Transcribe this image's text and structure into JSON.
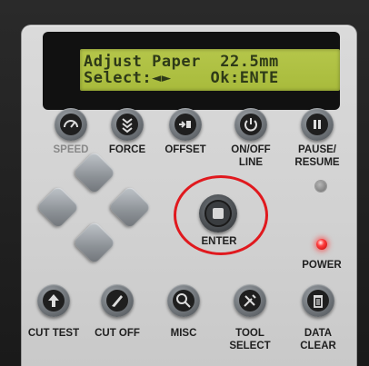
{
  "lcd": {
    "line1": "Adjust Paper  22.5mm",
    "line2": "Select:◄►    Ok:ENTE"
  },
  "buttons": {
    "speed": {
      "label": "SPEED",
      "icon": "speedometer-icon"
    },
    "force": {
      "label": "FORCE",
      "icon": "force-down-arrows-icon"
    },
    "offset": {
      "label": "OFFSET",
      "icon": "offset-icon"
    },
    "online": {
      "label_line1": "ON/OFF",
      "label_line2": "LINE",
      "icon": "power-icon"
    },
    "pause": {
      "label_line1": "PAUSE/",
      "label_line2": "RESUME",
      "icon": "pause-icon"
    },
    "enter": {
      "label": "ENTER",
      "icon": "stop-square-icon"
    },
    "power": {
      "label": "POWER"
    },
    "cut_test": {
      "label": "CUT TEST",
      "icon": "up-arrow-icon"
    },
    "cut_off": {
      "label": "CUT OFF",
      "icon": "blade-icon"
    },
    "misc": {
      "label": "MISC",
      "icon": "magnifier-icon"
    },
    "tool_select": {
      "label_line1": "TOOL",
      "label_line2": "SELECT",
      "icon": "tools-icon"
    },
    "data_clear": {
      "label_line1": "DATA",
      "label_line2": "CLEAR",
      "icon": "trash-icon"
    }
  },
  "colors": {
    "highlight": "#e0191e",
    "lcd_background": "#b0c244",
    "power_led": "#ff3b3b"
  }
}
